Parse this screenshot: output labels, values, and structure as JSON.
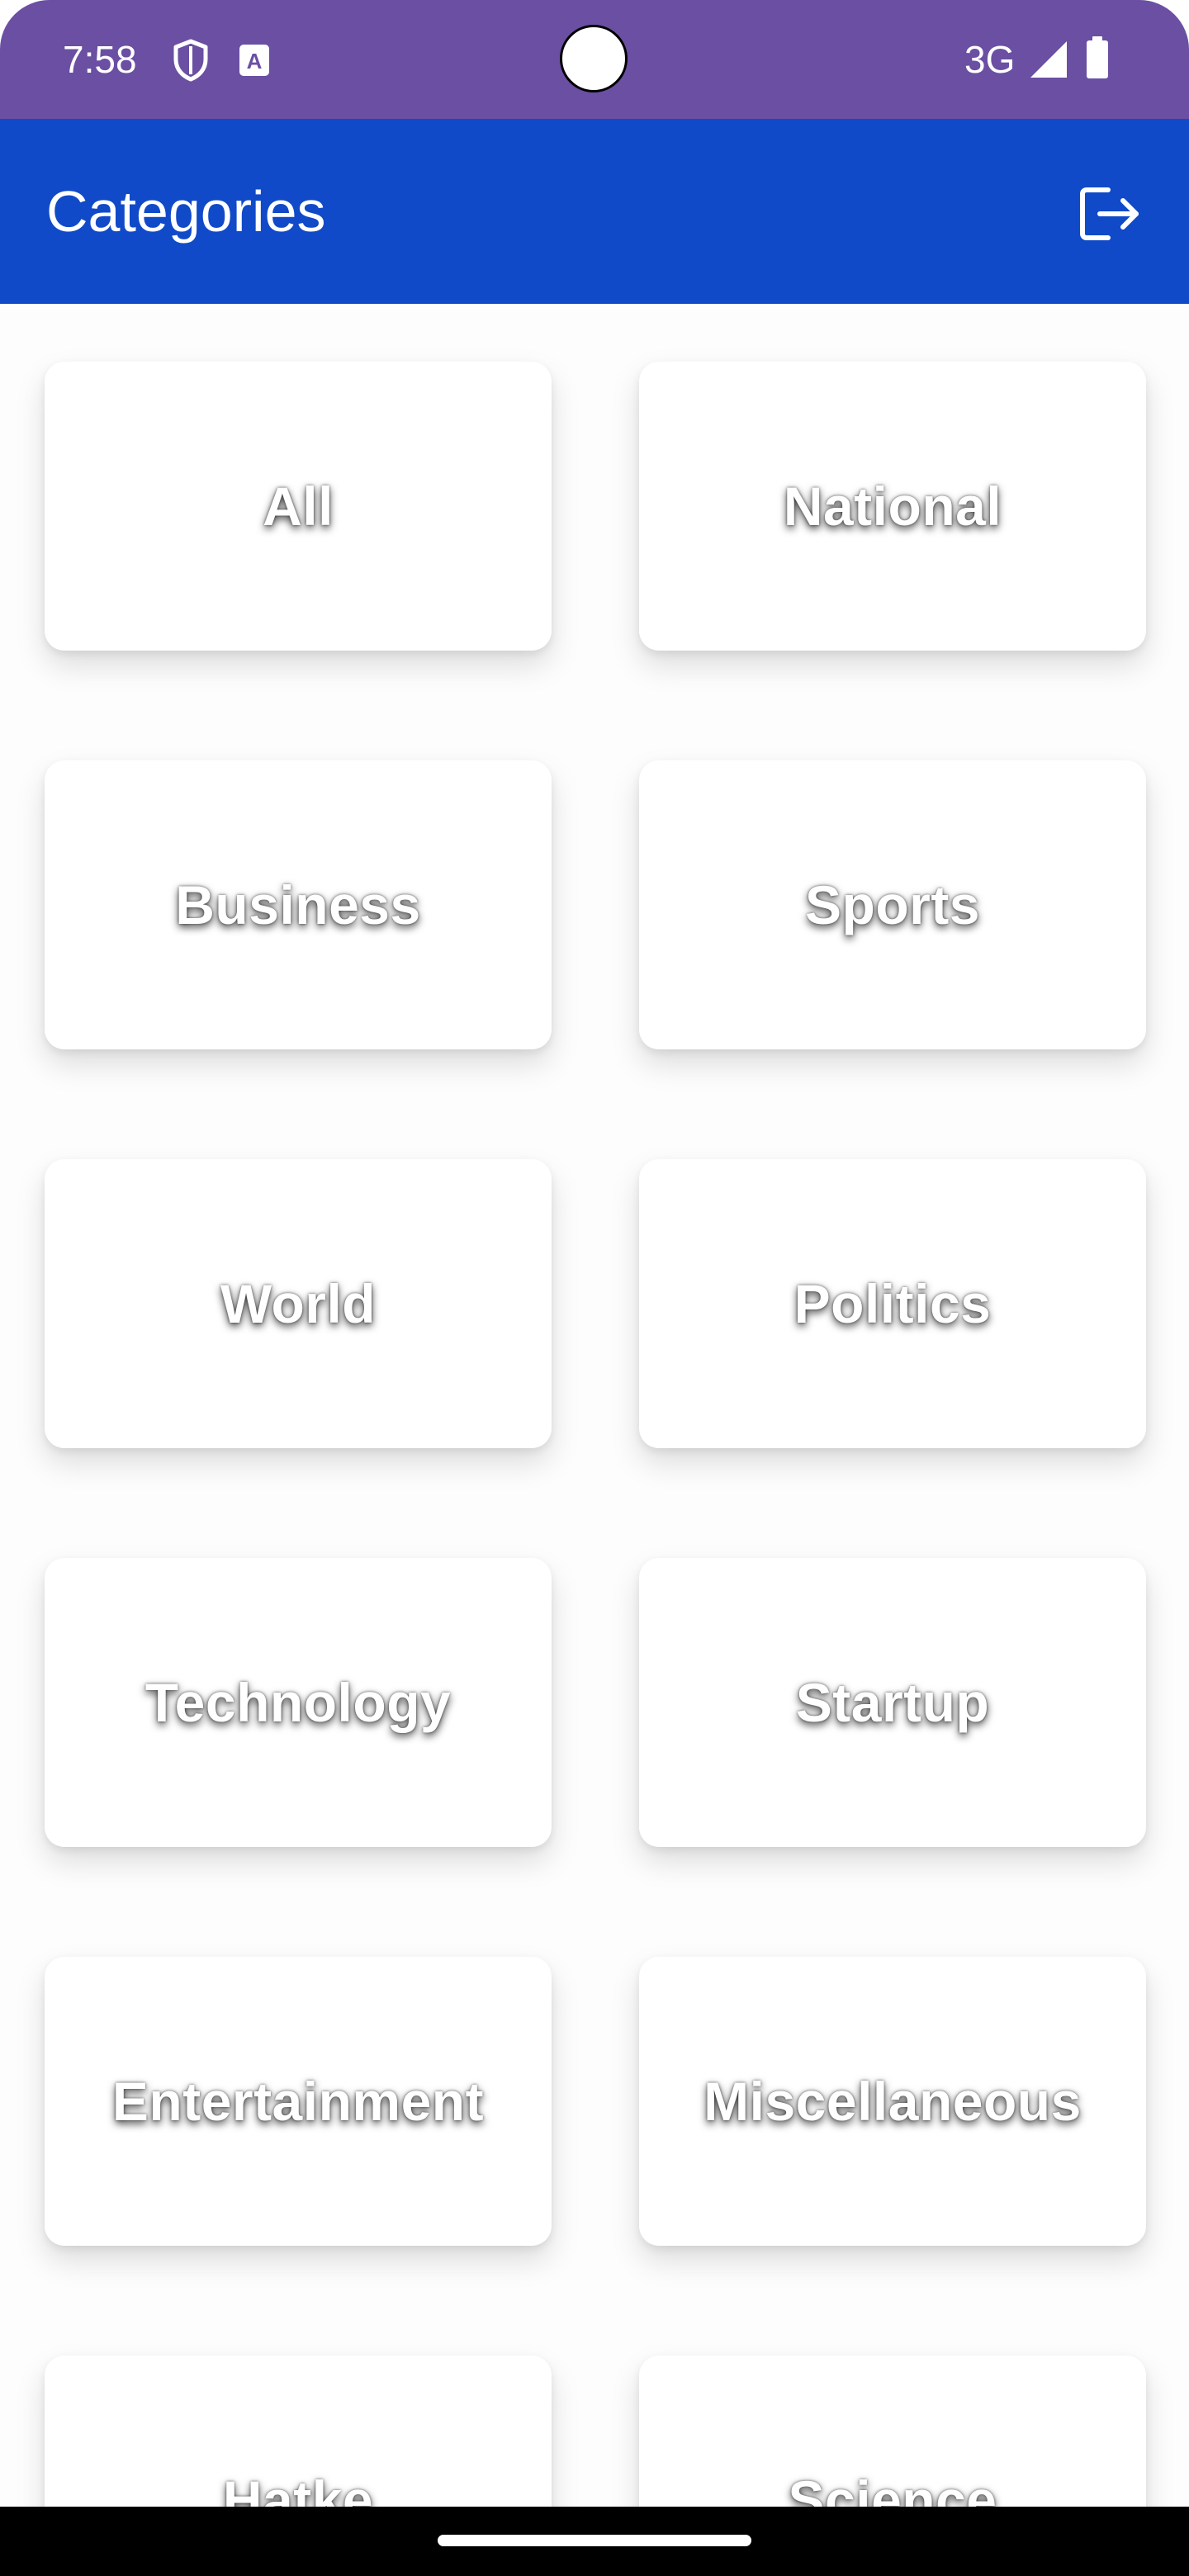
{
  "status_bar": {
    "time": "7:58",
    "network": "3G",
    "icons": [
      "shield-icon",
      "a-badge-icon",
      "signal-icon",
      "battery-icon"
    ],
    "color": "#6a4fa3"
  },
  "app_bar": {
    "title": "Categories",
    "action_icon": "logout-icon",
    "color": "#104ac8"
  },
  "categories": [
    "All",
    "National",
    "Business",
    "Sports",
    "World",
    "Politics",
    "Technology",
    "Startup",
    "Entertainment",
    "Miscellaneous",
    "Hatke",
    "Science"
  ]
}
